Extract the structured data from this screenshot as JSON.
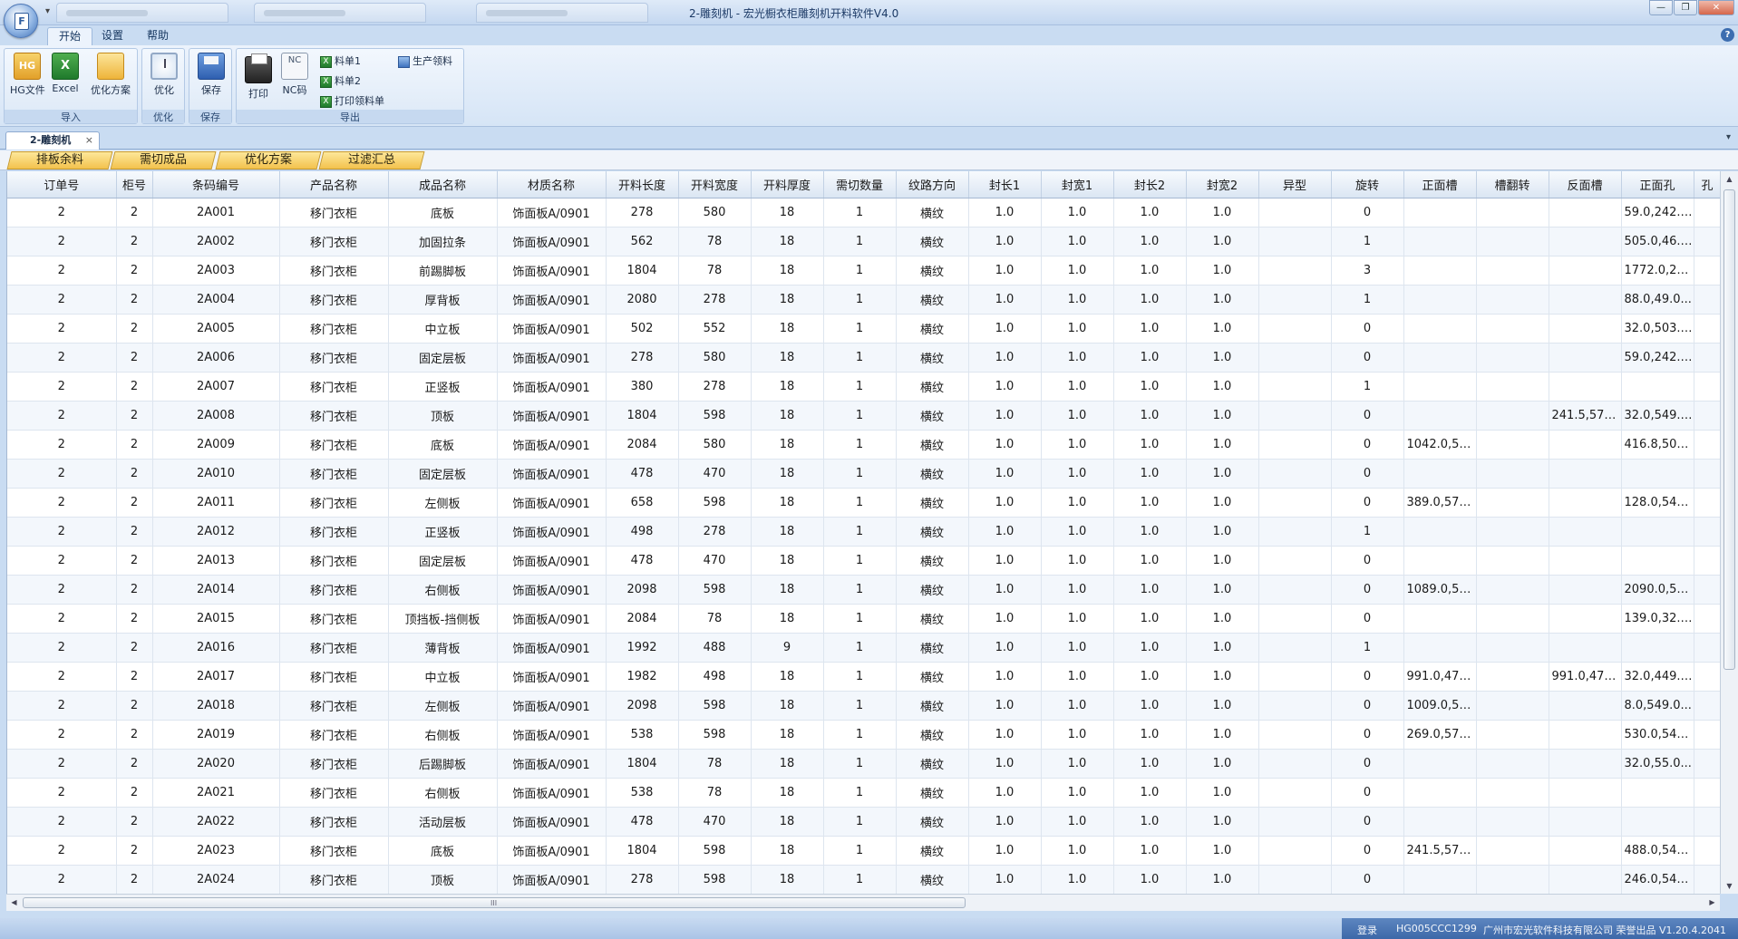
{
  "window": {
    "title": "2-雕刻机 - 宏光橱衣柜雕刻机开料软件V4.0",
    "orb_glyph": "F",
    "qat_glyph": "▾",
    "controls": {
      "minimize": "—",
      "restore": "❐",
      "close": "✕"
    }
  },
  "ribbon_tabs": [
    "开始",
    "设置",
    "帮助"
  ],
  "help_glyph": "?",
  "ribbon": {
    "groups": {
      "import": "导入",
      "optimize": "优化",
      "save": "保存",
      "export": "导出"
    },
    "buttons": {
      "hg_file": "HG文件",
      "hg_icon_text": "HG",
      "excel": "Excel",
      "excel_icon_text": "X",
      "plan": "优化方案",
      "optimize": "优化",
      "save": "保存",
      "print": "打印",
      "nc": "NC码",
      "nc_icon_text": "NC"
    },
    "small_items": {
      "sheet1": "料单1",
      "sheet2": "料单2",
      "print_pick": "打印领料单",
      "production_pick": "生产领料"
    }
  },
  "doc_tab": {
    "label": "2-雕刻机",
    "close": "×",
    "chevron": "▾"
  },
  "sub_tabs": [
    "排板余料",
    "需切成品",
    "优化方案",
    "过滤汇总"
  ],
  "grid": {
    "columns": [
      "订单号",
      "柜号",
      "条码编号",
      "产品名称",
      "成品名称",
      "材质名称",
      "开料长度",
      "开料宽度",
      "开料厚度",
      "需切数量",
      "纹路方向",
      "封长1",
      "封宽1",
      "封长2",
      "封宽2",
      "异型",
      "旋转",
      "正面槽",
      "槽翻转",
      "反面槽",
      "正面孔",
      "孔"
    ],
    "rows": [
      [
        "2",
        "2",
        "2A001",
        "移门衣柜",
        "底板",
        "饰面板A/0901",
        "278",
        "580",
        "18",
        "1",
        "横纹",
        "1.0",
        "1.0",
        "1.0",
        "1.0",
        "",
        "0",
        "",
        "",
        "",
        "59.0,242.0...",
        ""
      ],
      [
        "2",
        "2",
        "2A002",
        "移门衣柜",
        "加固拉条",
        "饰面板A/0901",
        "562",
        "78",
        "18",
        "1",
        "横纹",
        "1.0",
        "1.0",
        "1.0",
        "1.0",
        "",
        "1",
        "",
        "",
        "",
        "505.0,46.0...",
        ""
      ],
      [
        "2",
        "2",
        "2A003",
        "移门衣柜",
        "前踢脚板",
        "饰面板A/0901",
        "1804",
        "78",
        "18",
        "1",
        "横纹",
        "1.0",
        "1.0",
        "1.0",
        "1.0",
        "",
        "3",
        "",
        "",
        "",
        "1772.0,23....",
        ""
      ],
      [
        "2",
        "2",
        "2A004",
        "移门衣柜",
        "厚背板",
        "饰面板A/0901",
        "2080",
        "278",
        "18",
        "1",
        "横纹",
        "1.0",
        "1.0",
        "1.0",
        "1.0",
        "",
        "1",
        "",
        "",
        "",
        "88.0,49.0...",
        ""
      ],
      [
        "2",
        "2",
        "2A005",
        "移门衣柜",
        "中立板",
        "饰面板A/0901",
        "502",
        "552",
        "18",
        "1",
        "横纹",
        "1.0",
        "1.0",
        "1.0",
        "1.0",
        "",
        "0",
        "",
        "",
        "",
        "32.0,503.0...",
        ""
      ],
      [
        "2",
        "2",
        "2A006",
        "移门衣柜",
        "固定层板",
        "饰面板A/0901",
        "278",
        "580",
        "18",
        "1",
        "横纹",
        "1.0",
        "1.0",
        "1.0",
        "1.0",
        "",
        "0",
        "",
        "",
        "",
        "59.0,242.0...",
        ""
      ],
      [
        "2",
        "2",
        "2A007",
        "移门衣柜",
        "正竖板",
        "饰面板A/0901",
        "380",
        "278",
        "18",
        "1",
        "横纹",
        "1.0",
        "1.0",
        "1.0",
        "1.0",
        "",
        "1",
        "",
        "",
        "",
        "",
        ""
      ],
      [
        "2",
        "2",
        "2A008",
        "移门衣柜",
        "顶板",
        "饰面板A/0901",
        "1804",
        "598",
        "18",
        "1",
        "横纹",
        "1.0",
        "1.0",
        "1.0",
        "1.0",
        "",
        "0",
        "",
        "",
        "241.5,576....",
        "32.0,549.0...",
        ""
      ],
      [
        "2",
        "2",
        "2A009",
        "移门衣柜",
        "底板",
        "饰面板A/0901",
        "2084",
        "580",
        "18",
        "1",
        "横纹",
        "1.0",
        "1.0",
        "1.0",
        "1.0",
        "",
        "0",
        "1042.0,55....",
        "",
        "",
        "416.8,503....",
        ""
      ],
      [
        "2",
        "2",
        "2A010",
        "移门衣柜",
        "固定层板",
        "饰面板A/0901",
        "478",
        "470",
        "18",
        "1",
        "横纹",
        "1.0",
        "1.0",
        "1.0",
        "1.0",
        "",
        "0",
        "",
        "",
        "",
        "",
        ""
      ],
      [
        "2",
        "2",
        "2A011",
        "移门衣柜",
        "左侧板",
        "饰面板A/0901",
        "658",
        "598",
        "18",
        "1",
        "横纹",
        "1.0",
        "1.0",
        "1.0",
        "1.0",
        "",
        "0",
        "389.0,576....",
        "",
        "",
        "128.0,549....",
        ""
      ],
      [
        "2",
        "2",
        "2A012",
        "移门衣柜",
        "正竖板",
        "饰面板A/0901",
        "498",
        "278",
        "18",
        "1",
        "横纹",
        "1.0",
        "1.0",
        "1.0",
        "1.0",
        "",
        "1",
        "",
        "",
        "",
        "",
        ""
      ],
      [
        "2",
        "2",
        "2A013",
        "移门衣柜",
        "固定层板",
        "饰面板A/0901",
        "478",
        "470",
        "18",
        "1",
        "横纹",
        "1.0",
        "1.0",
        "1.0",
        "1.0",
        "",
        "0",
        "",
        "",
        "",
        "",
        ""
      ],
      [
        "2",
        "2",
        "2A014",
        "移门衣柜",
        "右侧板",
        "饰面板A/0901",
        "2098",
        "598",
        "18",
        "1",
        "横纹",
        "1.0",
        "1.0",
        "1.0",
        "1.0",
        "",
        "0",
        "1089.0,57....",
        "",
        "",
        "2090.0,54....",
        ""
      ],
      [
        "2",
        "2",
        "2A015",
        "移门衣柜",
        "顶挡板-挡侧板",
        "饰面板A/0901",
        "2084",
        "78",
        "18",
        "1",
        "横纹",
        "1.0",
        "1.0",
        "1.0",
        "1.0",
        "",
        "0",
        "",
        "",
        "",
        "139.0,32.0...",
        ""
      ],
      [
        "2",
        "2",
        "2A016",
        "移门衣柜",
        "薄背板",
        "饰面板A/0901",
        "1992",
        "488",
        "9",
        "1",
        "横纹",
        "1.0",
        "1.0",
        "1.0",
        "1.0",
        "",
        "1",
        "",
        "",
        "",
        "",
        ""
      ],
      [
        "2",
        "2",
        "2A017",
        "移门衣柜",
        "中立板",
        "饰面板A/0901",
        "1982",
        "498",
        "18",
        "1",
        "横纹",
        "1.0",
        "1.0",
        "1.0",
        "1.0",
        "",
        "0",
        "991.0,476....",
        "",
        "991.0,476....",
        "32.0,449.0...",
        ""
      ],
      [
        "2",
        "2",
        "2A018",
        "移门衣柜",
        "左侧板",
        "饰面板A/0901",
        "2098",
        "598",
        "18",
        "1",
        "横纹",
        "1.0",
        "1.0",
        "1.0",
        "1.0",
        "",
        "0",
        "1009.0,57....",
        "",
        "",
        "8.0,549.0...",
        ""
      ],
      [
        "2",
        "2",
        "2A019",
        "移门衣柜",
        "右侧板",
        "饰面板A/0901",
        "538",
        "598",
        "18",
        "1",
        "横纹",
        "1.0",
        "1.0",
        "1.0",
        "1.0",
        "",
        "0",
        "269.0,576....",
        "",
        "",
        "530.0,549....",
        ""
      ],
      [
        "2",
        "2",
        "2A020",
        "移门衣柜",
        "后踢脚板",
        "饰面板A/0901",
        "1804",
        "78",
        "18",
        "1",
        "横纹",
        "1.0",
        "1.0",
        "1.0",
        "1.0",
        "",
        "0",
        "",
        "",
        "",
        "32.0,55.0...",
        ""
      ],
      [
        "2",
        "2",
        "2A021",
        "移门衣柜",
        "右侧板",
        "饰面板A/0901",
        "538",
        "78",
        "18",
        "1",
        "横纹",
        "1.0",
        "1.0",
        "1.0",
        "1.0",
        "",
        "0",
        "",
        "",
        "",
        "",
        ""
      ],
      [
        "2",
        "2",
        "2A022",
        "移门衣柜",
        "活动层板",
        "饰面板A/0901",
        "478",
        "470",
        "18",
        "1",
        "横纹",
        "1.0",
        "1.0",
        "1.0",
        "1.0",
        "",
        "0",
        "",
        "",
        "",
        "",
        ""
      ],
      [
        "2",
        "2",
        "2A023",
        "移门衣柜",
        "底板",
        "饰面板A/0901",
        "1804",
        "598",
        "18",
        "1",
        "横纹",
        "1.0",
        "1.0",
        "1.0",
        "1.0",
        "",
        "0",
        "241.5,576....",
        "",
        "",
        "488.0,549....",
        ""
      ],
      [
        "2",
        "2",
        "2A024",
        "移门衣柜",
        "顶板",
        "饰面板A/0901",
        "278",
        "598",
        "18",
        "1",
        "横纹",
        "1.0",
        "1.0",
        "1.0",
        "1.0",
        "",
        "0",
        "",
        "",
        "",
        "246.0,549....",
        ""
      ]
    ]
  },
  "scroll": {
    "up": "▲",
    "down": "▼",
    "left": "◀",
    "right": "▶",
    "grip": "III",
    "vgrip": "≡"
  },
  "status": {
    "login": "登录",
    "machine": "HG005CCC1299",
    "company": "广州市宏光软件科技有限公司 荣誉出品 V1.20.4.2041"
  }
}
